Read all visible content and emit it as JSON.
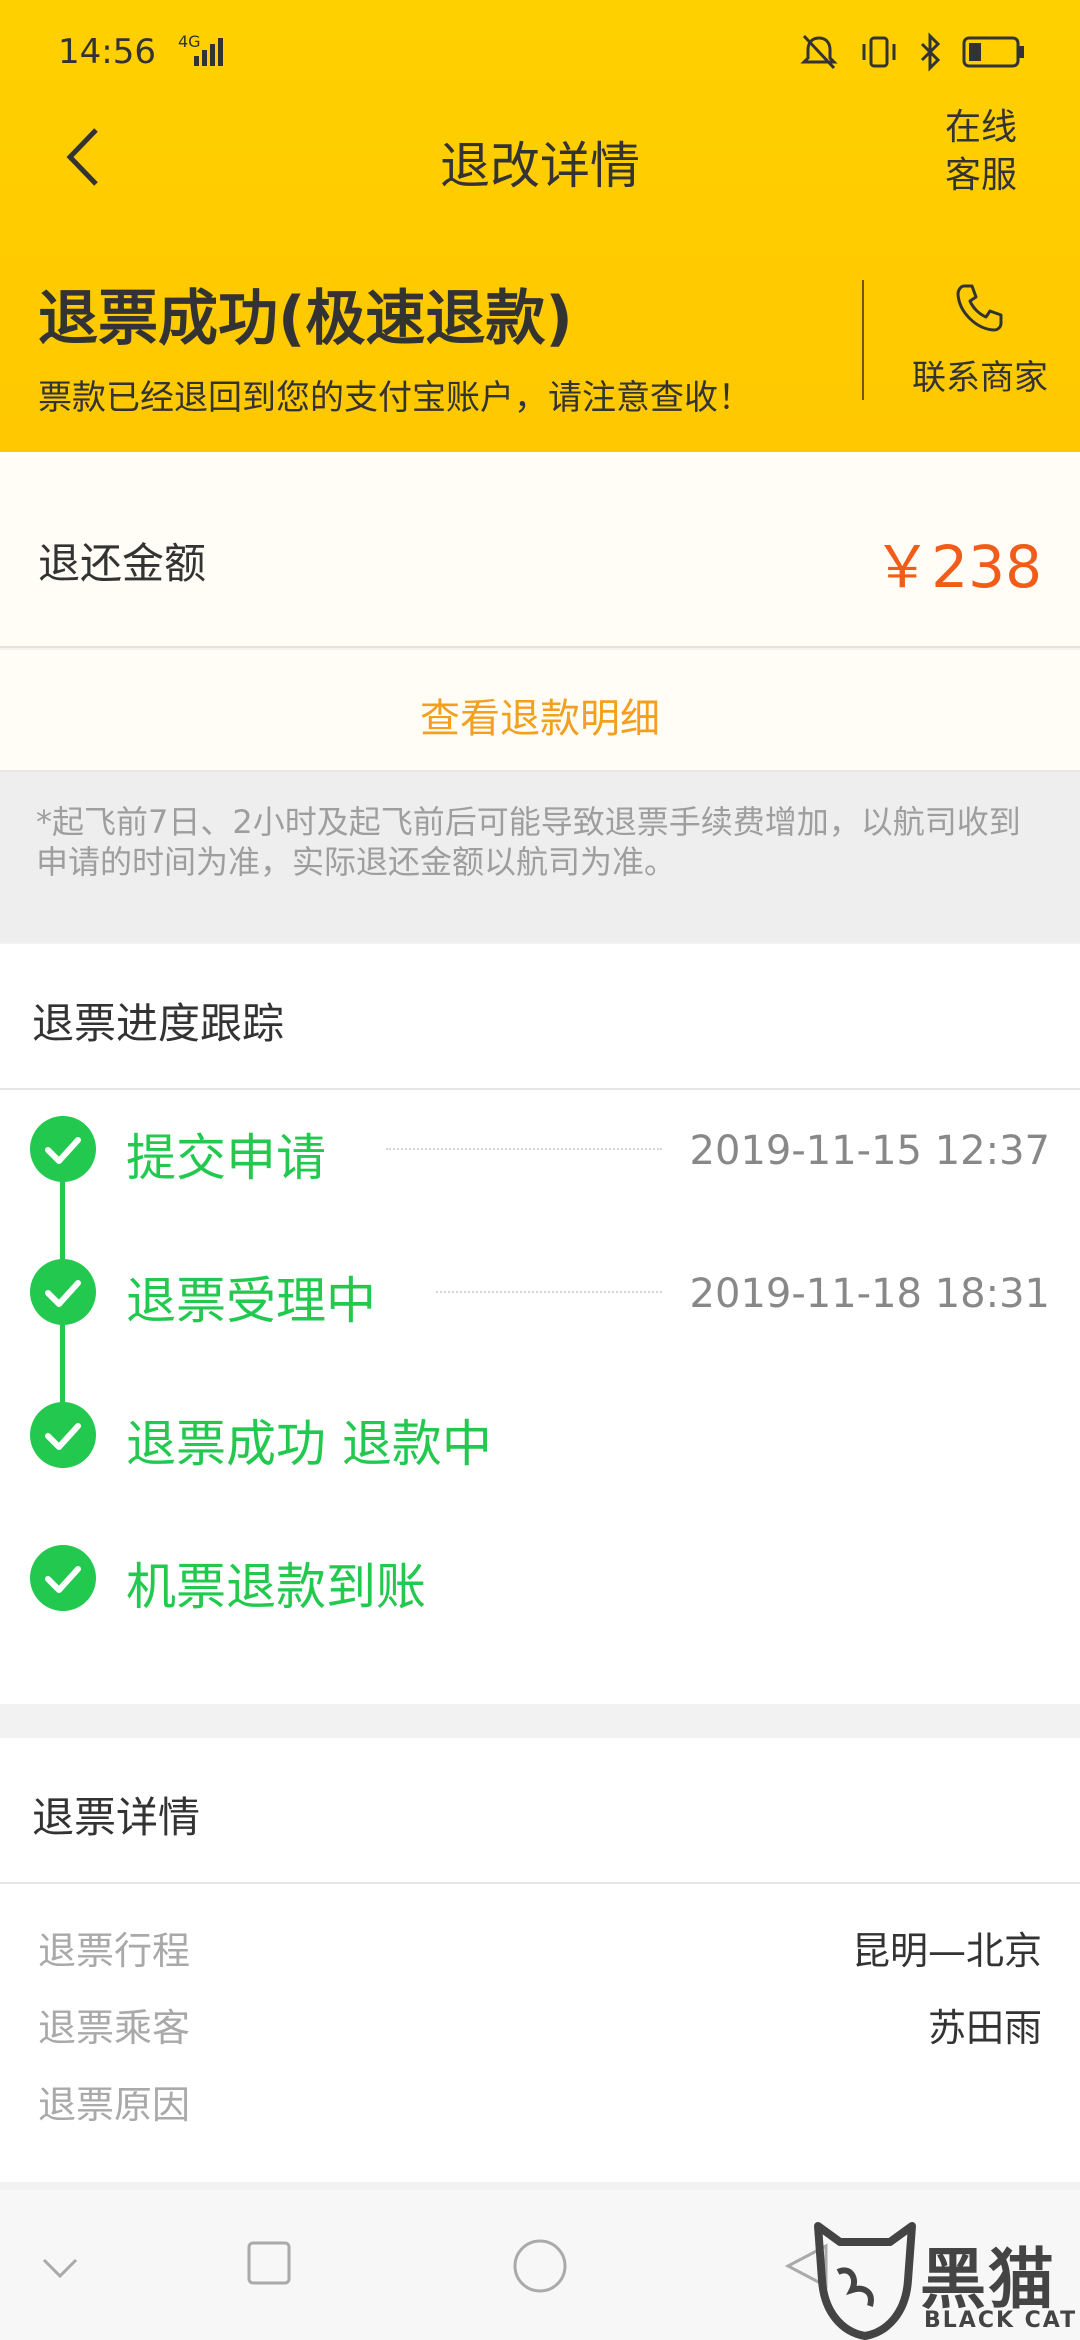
{
  "status_bar": {
    "time": "14:56",
    "network": "4G"
  },
  "nav": {
    "title": "退改详情",
    "service_line1": "在线",
    "service_line2": "客服"
  },
  "refund_status": {
    "title": "退票成功(极速退款)",
    "subtitle": "票款已经退回到您的支付宝账户，请注意查收！",
    "contact_label": "联系商家"
  },
  "amount": {
    "label": "退还金额",
    "value": "￥238"
  },
  "detail_link": "查看退款明细",
  "notice": "*起飞前7日、2小时及起飞前后可能导致退票手续费增加，以航司收到申请的时间为准，实际退还金额以航司为准。",
  "progress": {
    "title": "退票进度跟踪",
    "steps": [
      {
        "label": "提交申请",
        "time": "2019-11-15 12:37"
      },
      {
        "label": "退票受理中",
        "time": "2019-11-18 18:31"
      },
      {
        "label": "退票成功 退款中",
        "time": ""
      },
      {
        "label": "机票退款到账",
        "time": ""
      }
    ]
  },
  "refund_detail": {
    "title": "退票详情",
    "rows": [
      {
        "key": "退票行程",
        "value": "昆明—北京"
      },
      {
        "key": "退票乘客",
        "value": "苏田雨"
      },
      {
        "key": "退票原因",
        "value": ""
      }
    ]
  },
  "watermark": {
    "cn": "黑猫",
    "en": "BLACK CAT"
  },
  "colors": {
    "header_yellow": "#FFC800",
    "accent_orange": "#F25C19",
    "link_orange": "#F3A020",
    "success_green": "#22C94E"
  },
  "icons": [
    "back-arrow-icon",
    "phone-icon",
    "check-circle-icon",
    "mute-icon",
    "vibrate-icon",
    "bluetooth-icon",
    "battery-icon"
  ]
}
